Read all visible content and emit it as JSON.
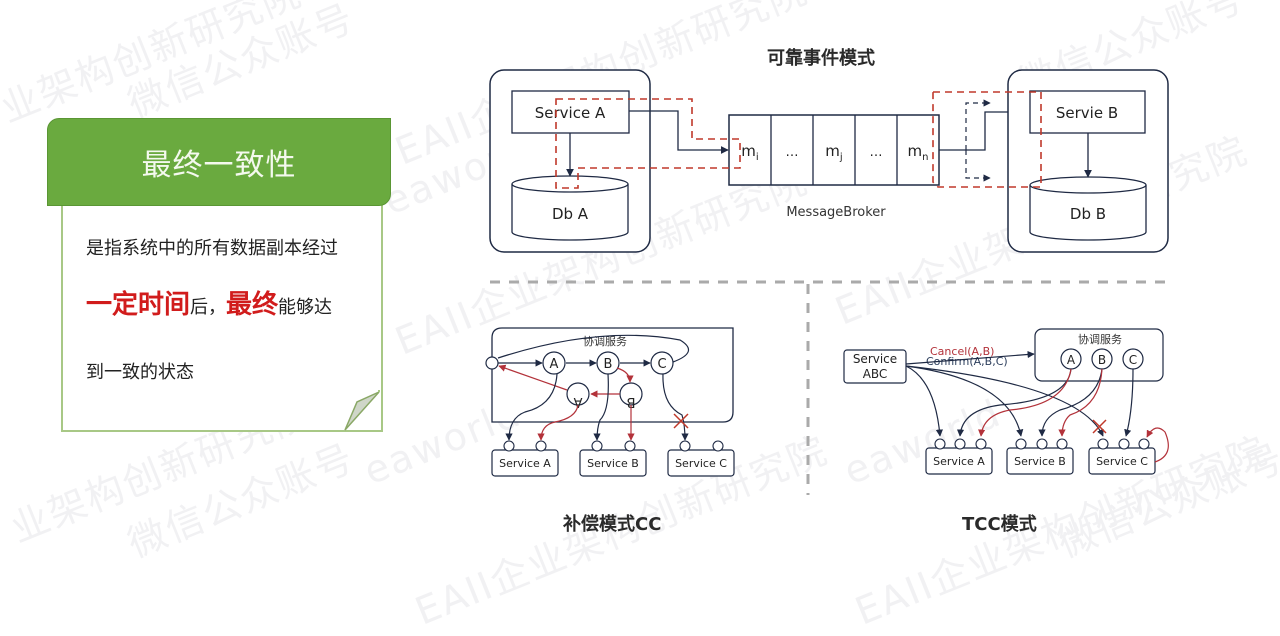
{
  "watermarks": [
    "业架构创新研究院",
    "微信公众账号",
    "EAII企业架构创新研究院",
    "eaworld"
  ],
  "card": {
    "title": "最终一致性",
    "line1": "是指系统中的所有数据副本经过",
    "line2_red1": "一定时间",
    "line2_mid": "后，",
    "line2_red2": "最终",
    "line2_end": "能够达",
    "line3": "到一致的状态",
    "colors": {
      "header": "#6aaa3f",
      "emphasis": "#d11c1c"
    }
  },
  "reliable_event": {
    "title": "可靠事件模式",
    "service_a": "Service A",
    "db_a": "Db A",
    "service_b": "Servie B",
    "db_b": "Db B",
    "broker_label": "MessageBroker",
    "queue": [
      {
        "base": "m",
        "sub": "i"
      },
      {
        "base": "…",
        "sub": ""
      },
      {
        "base": "m",
        "sub": "j"
      },
      {
        "base": "…",
        "sub": ""
      },
      {
        "base": "m",
        "sub": "n"
      }
    ]
  },
  "compensation": {
    "title": "补偿模式CC",
    "coordinator": "协调服务",
    "nodes": [
      "A",
      "B",
      "C"
    ],
    "reverse_nodes": [
      "A",
      "B"
    ],
    "services": [
      "Service A",
      "Service B",
      "Service C"
    ]
  },
  "tcc": {
    "title": "TCC模式",
    "caller": [
      "Service",
      "ABC"
    ],
    "cancel_label": "Cancel(A,B)",
    "confirm_label": "Confirm(A,B,C)",
    "coordinator": "协调服务",
    "nodes": [
      "A",
      "B",
      "C"
    ],
    "services": [
      "Service A",
      "Service B",
      "Service C"
    ]
  },
  "colors": {
    "line": "#1f2a44",
    "dash_red": "#c0392b",
    "cancel_red": "#b3323a",
    "divider": "#aaaaaa"
  }
}
